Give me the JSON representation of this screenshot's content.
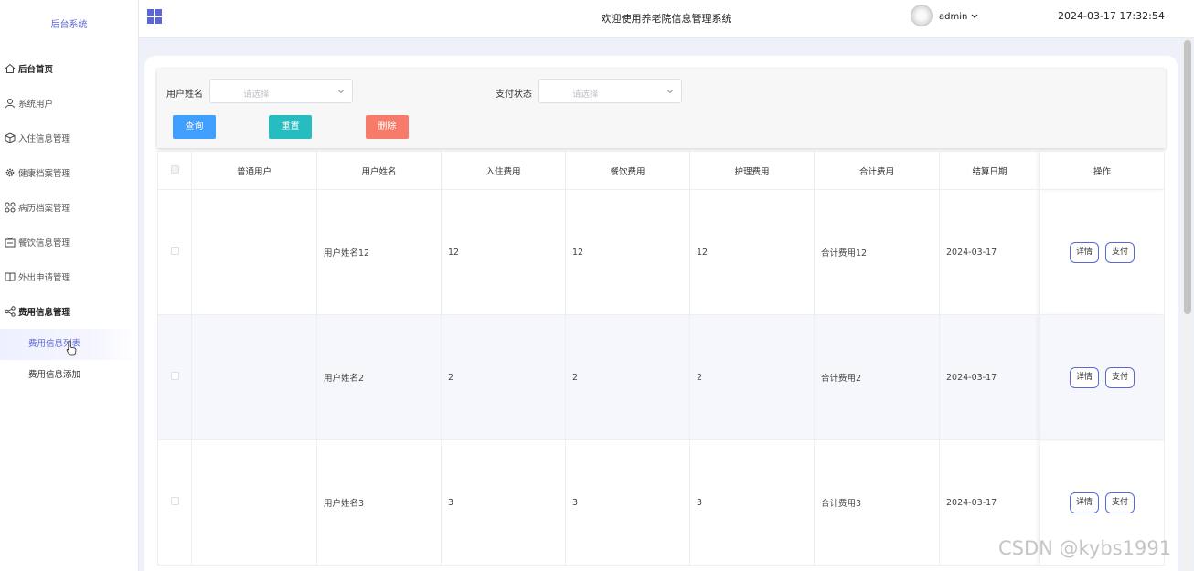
{
  "sidebar": {
    "brand": "后台系统",
    "items": [
      {
        "label": "后台首页",
        "icon": "home-icon"
      },
      {
        "label": "系统用户",
        "icon": "user-icon"
      },
      {
        "label": "入住信息管理",
        "icon": "cube-icon"
      },
      {
        "label": "健康档案管理",
        "icon": "gear-icon"
      },
      {
        "label": "病历档案管理",
        "icon": "grid-icon"
      },
      {
        "label": "餐饮信息管理",
        "icon": "tray-icon"
      },
      {
        "label": "外出申请管理",
        "icon": "book-icon"
      },
      {
        "label": "费用信息管理",
        "icon": "share-icon"
      }
    ],
    "submenu": [
      {
        "label": "费用信息列表"
      },
      {
        "label": "费用信息添加"
      }
    ]
  },
  "header": {
    "title": "欢迎使用养老院信息管理系统",
    "user": "admin",
    "datetime": "2024-03-17 17:32:54"
  },
  "search": {
    "name_label": "用户姓名",
    "name_placeholder": "请选择",
    "status_label": "支付状态",
    "status_placeholder": "请选择",
    "query_label": "查询",
    "reset_label": "重置",
    "delete_label": "删除"
  },
  "table": {
    "headers": [
      "普通用户",
      "用户姓名",
      "入住费用",
      "餐饮费用",
      "护理费用",
      "合计费用",
      "结算日期",
      "操作"
    ],
    "detail_label": "详情",
    "pay_label": "支付",
    "rows": [
      {
        "user": "",
        "name": "用户姓名12",
        "stay": "12",
        "food": "12",
        "care": "12",
        "total": "合计费用12",
        "date": "2024-03-17"
      },
      {
        "user": "",
        "name": "用户姓名2",
        "stay": "2",
        "food": "2",
        "care": "2",
        "total": "合计费用2",
        "date": "2024-03-17"
      },
      {
        "user": "",
        "name": "用户姓名3",
        "stay": "3",
        "food": "3",
        "care": "3",
        "total": "合计费用3",
        "date": "2024-03-17"
      }
    ]
  },
  "watermark": "CSDN @kybs1991"
}
